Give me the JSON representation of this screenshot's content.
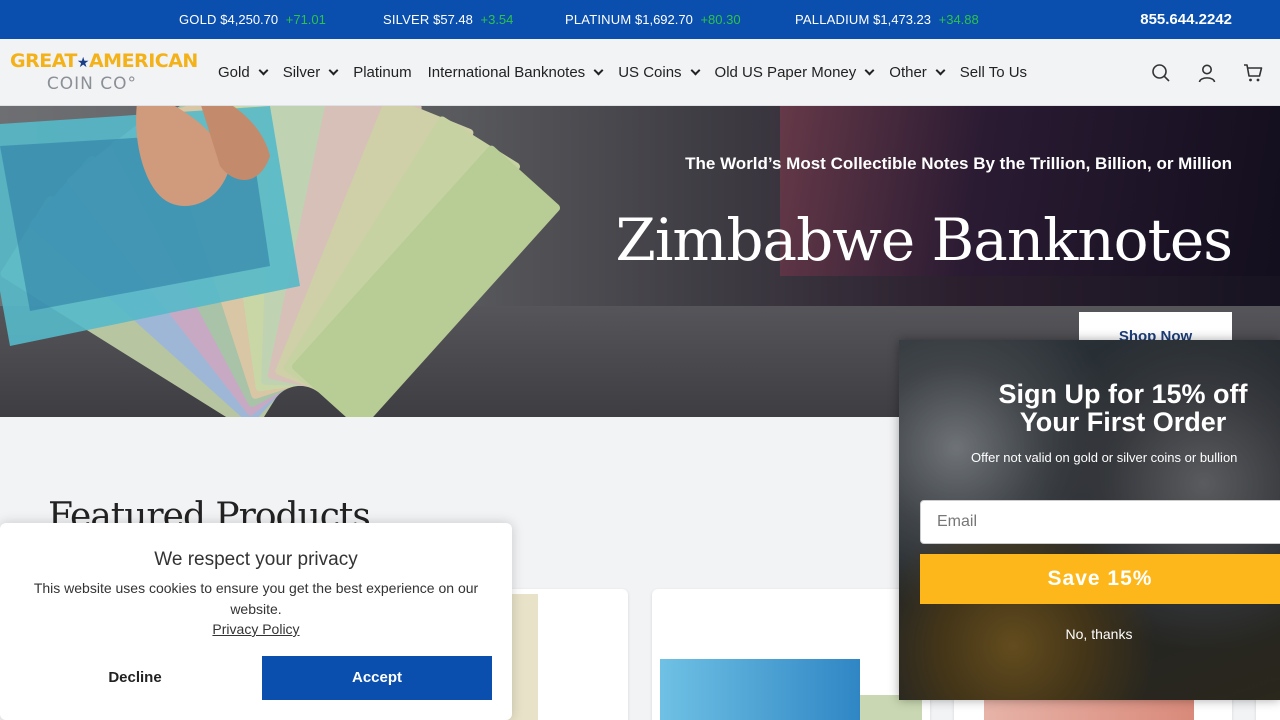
{
  "ticker": {
    "items": [
      {
        "label": "GOLD",
        "price": "$4,250.70",
        "change": "+71.01"
      },
      {
        "label": "SILVER",
        "price": "$57.48",
        "change": "+3.54"
      },
      {
        "label": "PLATINUM",
        "price": "$1,692.70",
        "change": "+80.30"
      },
      {
        "label": "PALLADIUM",
        "price": "$1,473.23",
        "change": "+34.88"
      }
    ],
    "phone": "855.644.2242"
  },
  "header": {
    "logo_line1": "GREAT",
    "logo_star": "★",
    "logo_line1b": "AMERICAN",
    "logo_line2": "COIN CO°",
    "nav": [
      {
        "label": "Gold"
      },
      {
        "label": "Silver"
      },
      {
        "label": "Platinum"
      },
      {
        "label": "International Banknotes"
      },
      {
        "label": "US Coins"
      },
      {
        "label": "Old US Paper Money"
      },
      {
        "label": "Other"
      },
      {
        "label": "Sell To Us"
      }
    ],
    "icons": [
      "search-icon",
      "account-icon",
      "cart-icon"
    ]
  },
  "hero": {
    "subtitle": "The World’s Most Collectible Notes By the Trillion, Billion, or Million",
    "title": "Zimbabwe Banknotes",
    "cta": "Shop Now"
  },
  "featured": {
    "heading": "Featured Products"
  },
  "cookie": {
    "title": "We respect your privacy",
    "body": "This website uses cookies to ensure you get the best experience on our website.",
    "link": "Privacy Policy",
    "decline": "Decline",
    "accept": "Accept"
  },
  "signup": {
    "title_line1": "Sign Up for 15% off",
    "title_line2": "Your First Order",
    "subtitle": "Offer not valid on gold or silver coins or bullion",
    "email_placeholder": "Email",
    "save": "Save 15%",
    "no_thanks": "No, thanks"
  },
  "colors": {
    "brand_blue": "#0a4fae",
    "ticker_green": "#2ec24a",
    "logo_gold": "#f4b21a",
    "save_yellow": "#fdb71a"
  }
}
